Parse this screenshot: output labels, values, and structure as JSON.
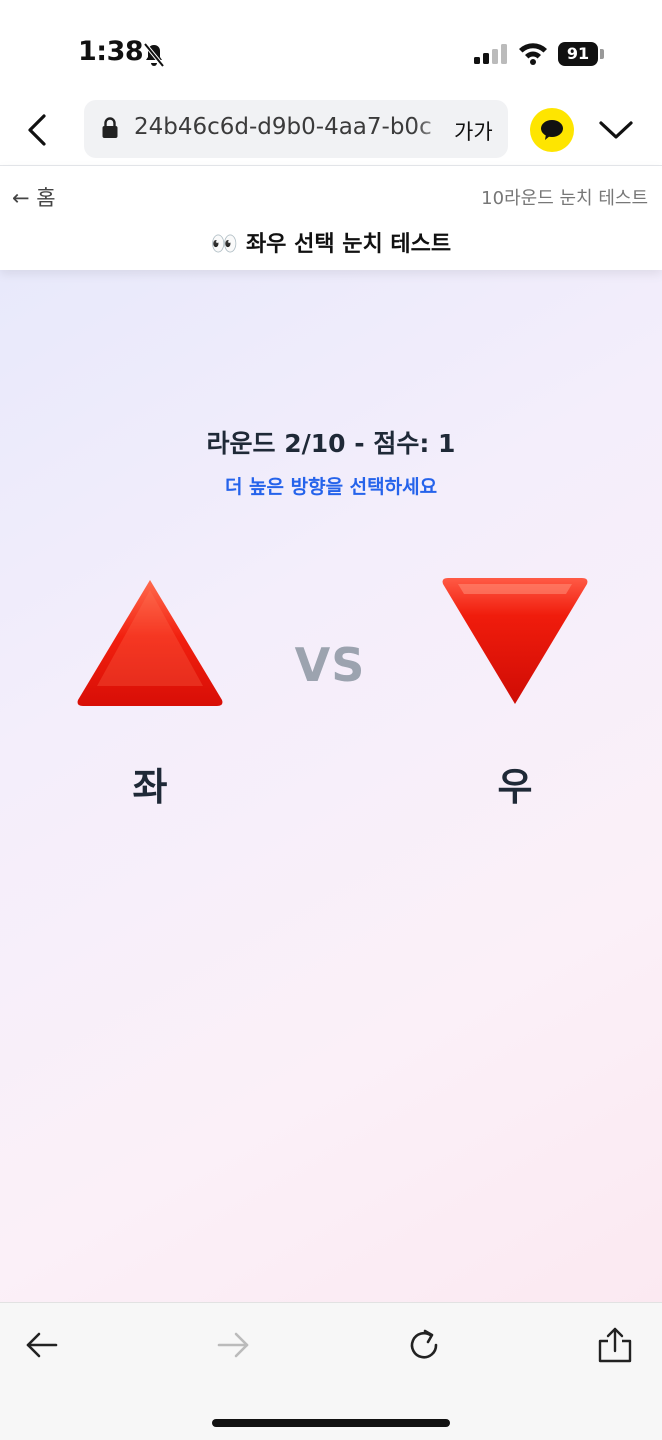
{
  "status_bar": {
    "time": "1:38",
    "battery": "91"
  },
  "browser": {
    "url": "24b46c6d-d9b0-4aa7-b0c",
    "text_size_label": "가가"
  },
  "header": {
    "home_label": "← 홈",
    "subtitle": "10라운드 눈치 테스트",
    "title": "👀 좌우 선택 눈치 테스트"
  },
  "game": {
    "round_info": "라운드 2/10 - 점수: 1",
    "instruction": "더 높은 방향을 선택하세요",
    "left_label": "좌",
    "right_label": "우",
    "vs_label": "VS",
    "left_emoji": "up-triangle-icon",
    "right_emoji": "down-triangle-icon"
  },
  "colors": {
    "triangle_red": "#E8170D",
    "instruction_blue": "#2563EB",
    "vs_gray": "#9CA3AF",
    "kakao_yellow": "#FEE500"
  }
}
